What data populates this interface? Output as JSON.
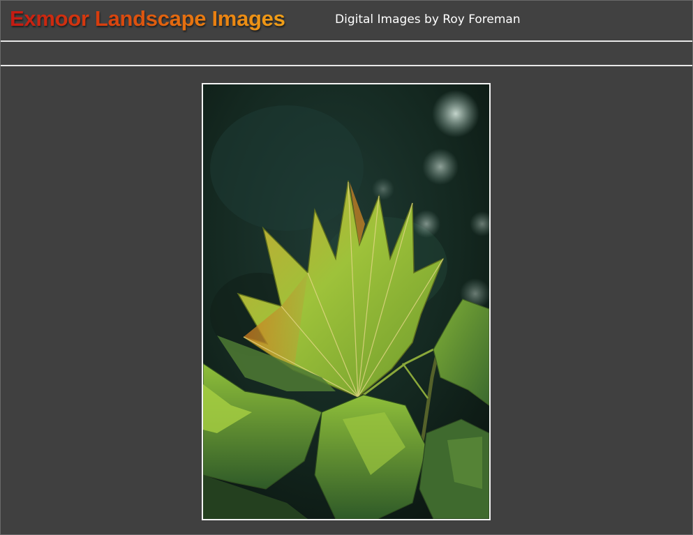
{
  "header": {
    "site_title": "Exmoor Landscape Images",
    "site_subtitle": "Digital Images by Roy Foreman"
  },
  "colors": {
    "page_background": "#404040",
    "rule_line": "#e8e8e8",
    "title_gradient_start": "#c41a12",
    "title_gradient_end": "#f0a018",
    "subtitle_text": "#ffffff",
    "photo_border": "#f4f4f4"
  },
  "photo": {
    "subject_icon": "maple-leaf-photo"
  }
}
